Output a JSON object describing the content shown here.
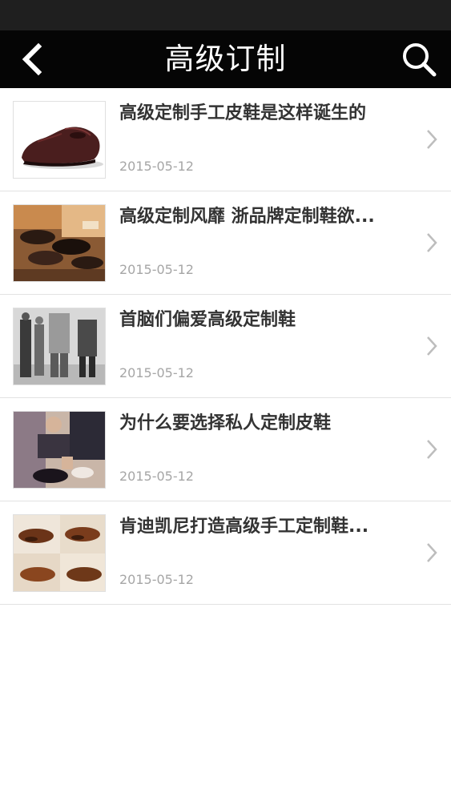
{
  "header": {
    "title": "高级订制",
    "back_icon": "back-arrow-icon",
    "search_icon": "search-icon"
  },
  "colors": {
    "status_bar": "#1f1f1f",
    "nav_bar": "#050505",
    "title_text": "#333333",
    "date_text": "#a6a6a6"
  },
  "articles": [
    {
      "title": "高级定制手工皮鞋是这样诞生的",
      "date": "2015-05-12",
      "thumbnail": "leather-oxford-shoe"
    },
    {
      "title": "高级定制风靡 浙品牌定制鞋欲...",
      "date": "2015-05-12",
      "thumbnail": "shoe-workshop-display"
    },
    {
      "title": "首脑们偏爱高级定制鞋",
      "date": "2015-05-12",
      "thumbnail": "leaders-walking-photo"
    },
    {
      "title": "为什么要选择私人定制皮鞋",
      "date": "2015-05-12",
      "thumbnail": "shoe-fitting-photo"
    },
    {
      "title": "肯迪凯尼打造高级手工定制鞋...",
      "date": "2015-05-12",
      "thumbnail": "brown-shoes-grid"
    }
  ]
}
